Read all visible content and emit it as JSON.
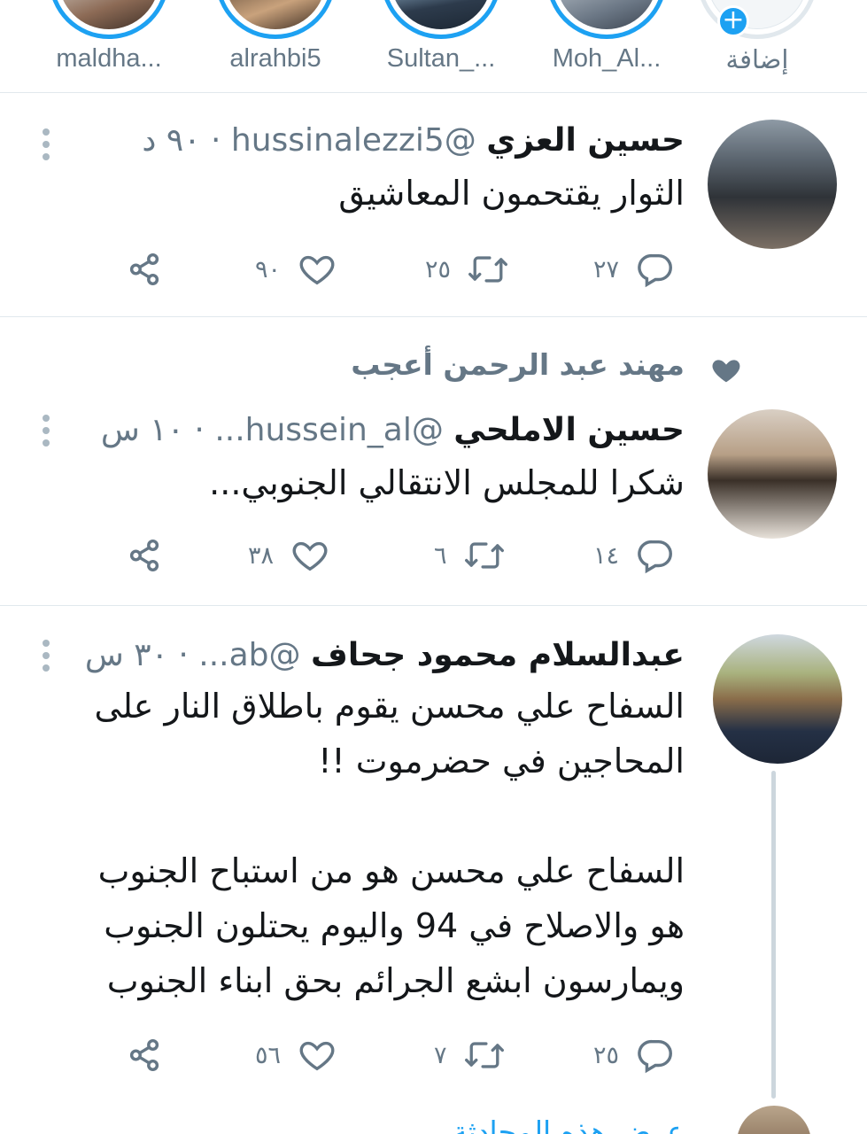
{
  "fleets": [
    {
      "label": "إضافة",
      "is_add": true
    },
    {
      "label": "Moh_Al..."
    },
    {
      "label": "Sultan_..."
    },
    {
      "label": "alrahbi5"
    },
    {
      "label": "maldha..."
    }
  ],
  "tweets": [
    {
      "name": "حسين العزي",
      "handle": "@hussinalezzi5",
      "time": "· ٩٠ د",
      "body": [
        "الثوار يقتحمون المعاشيق"
      ],
      "replies": "٢٧",
      "retweets": "٢٥",
      "likes": "٩٠"
    },
    {
      "social_context": "مهند عبد الرحمن أعجب",
      "name": "حسين الاملحي",
      "handle": "@hussein_al...",
      "time": "· ١٠ س",
      "body": [
        "شكرا للمجلس الانتقالي الجنوبي..."
      ],
      "replies": "١٤",
      "retweets": "٦",
      "likes": "٣٨"
    },
    {
      "name": "عبدالسلام محمود جحاف",
      "handle": "@ab...",
      "time": "· ٣٠ س",
      "body": [
        "السفاح علي محسن يقوم باطلاق النار على",
        "المحاجين في حضرموت !!",
        "",
        "السفاح علي محسن هو من استباح الجنوب",
        "هو والاصلاح في 94 واليوم يحتلون الجنوب",
        "ويمارسون ابشع الجرائم بحق ابناء الجنوب"
      ],
      "replies": "٢٥",
      "retweets": "٧",
      "likes": "٥٦"
    }
  ],
  "thread_more": "عرض هذه المحادثة",
  "colors": {
    "accent": "#1da1f2",
    "muted": "#657786",
    "divider": "#e1e8ed",
    "text": "#14171a"
  }
}
